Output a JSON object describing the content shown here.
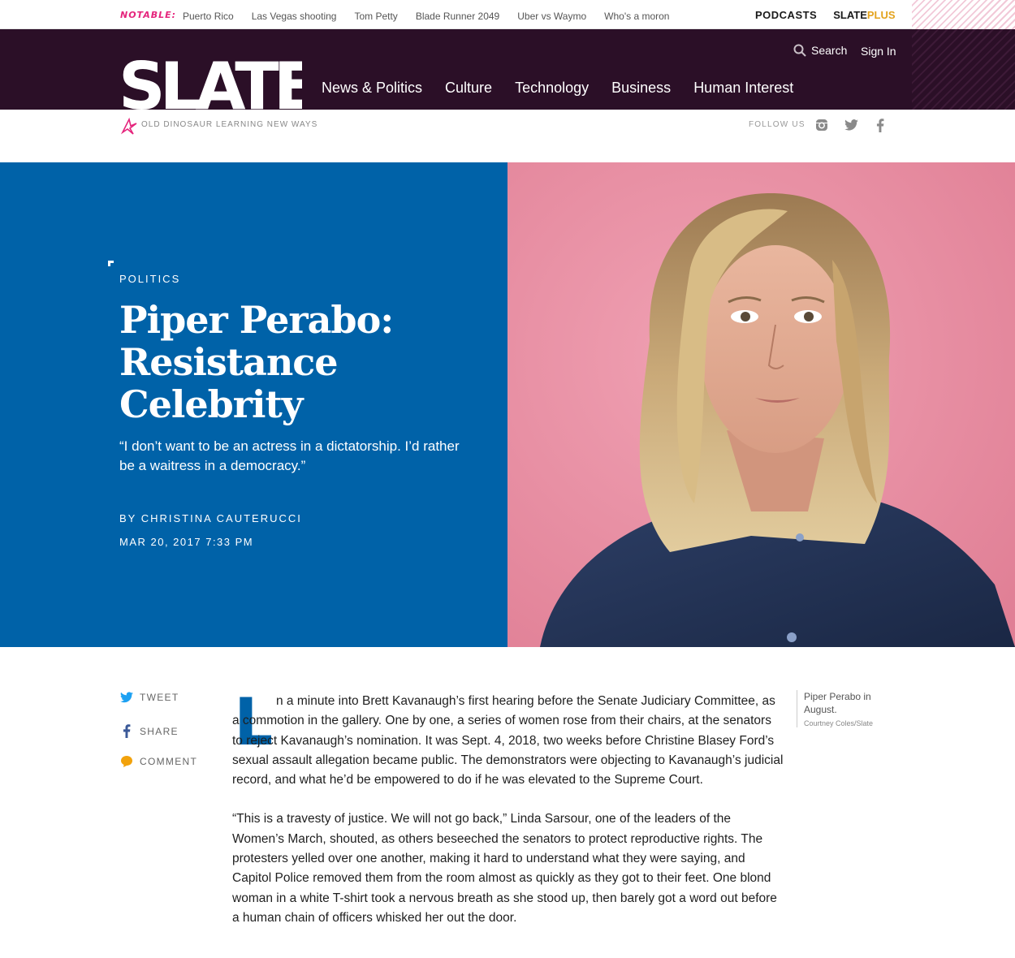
{
  "notable": {
    "label": "NOTABLE:",
    "links": [
      "Puerto Rico",
      "Las Vegas shooting",
      "Tom Petty",
      "Blade Runner 2049",
      "Uber vs Waymo",
      "Who's a moron"
    ]
  },
  "brands": {
    "podcasts": "PODCASTS",
    "slateplus_a": "SLATE",
    "slateplus_b": "PLUS"
  },
  "masthead": {
    "logo": "SLATE",
    "nav": [
      "News & Politics",
      "Culture",
      "Technology",
      "Business",
      "Human Interest"
    ],
    "search_label": "Search",
    "signin_label": "Sign In"
  },
  "subbar": {
    "tagline": "OLD DINOSAUR LEARNING NEW WAYS",
    "follow_label": "FOLLOW US",
    "social_icons": [
      "instagram-icon",
      "twitter-icon",
      "facebook-icon"
    ]
  },
  "article": {
    "section": "POLITICS",
    "headline": "Piper Perabo: Resistance Celebrity",
    "dek": "“I don’t want to be an actress in a dictatorship. I’d rather be a waitress in a democracy.”",
    "byline": "BY  CHRISTINA CAUTERUCCI",
    "date": "MAR 20, 2017 7:33 PM",
    "dropcap": "L",
    "paragraphs": [
      "n a minute into Brett Kavanaugh’s first hearing before the Senate Judiciary Committee, as a commotion in the gallery. One by one, a series of women rose from their chairs, at the senators to reject Kavanaugh’s nomination. It was Sept. 4, 2018, two weeks before Christine Blasey Ford’s sexual assault allegation became public. The demonstrators were objecting to Kavanaugh’s judicial record, and what he’d be empowered to do if he was elevated to the Supreme Court.",
      "“This is a travesty of justice. We will not go back,” Linda Sarsour, one of the leaders of the Women’s March, shouted, as others beseeched the senators to protect reproductive rights. The protesters yelled over one another, making it hard to understand what they were saying, and Capitol Police removed them from the room almost as quickly as they got to their feet. One blond woman in a white T-shirt took a nervous breath as she stood up, then barely got a word out before a human chain of officers whisked her out the door."
    ],
    "caption": "Piper Perabo in August.",
    "credit": "Courtney Coles/Slate"
  },
  "share": {
    "tweet": "TWEET",
    "share": "SHARE",
    "comment": "COMMENT"
  },
  "colors": {
    "masthead": "#2b0f27",
    "hero": "#0062a8",
    "photo_bg": "#e98fa3",
    "accent": "#e5247c"
  }
}
